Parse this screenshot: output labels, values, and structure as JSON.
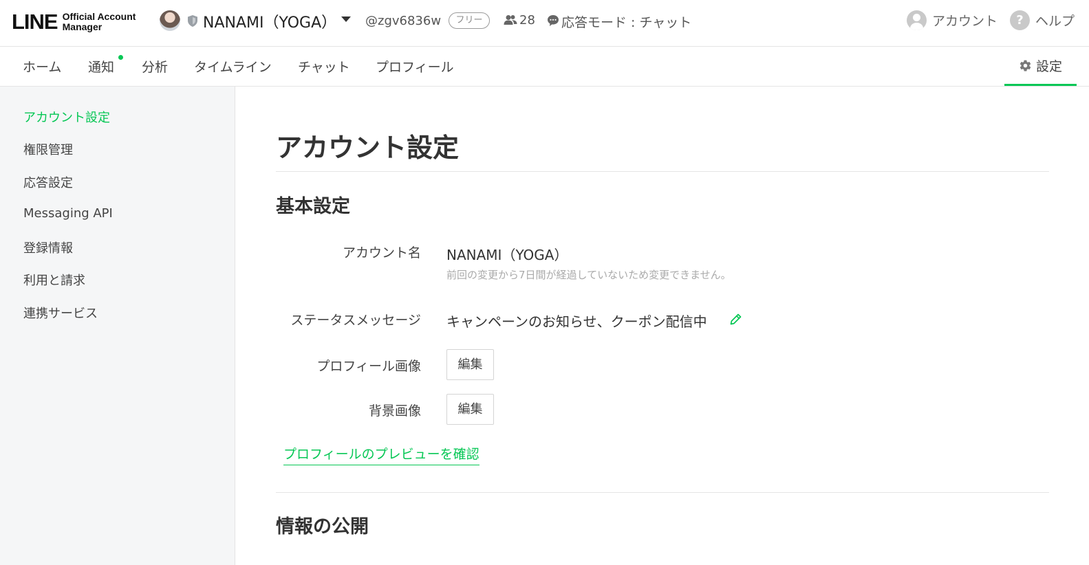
{
  "header": {
    "logo_line": "LINE",
    "logo_sub_1": "Official Account",
    "logo_sub_2": "Manager",
    "account_name": "NANAMI（YOGA）",
    "account_id": "@zgv6836w",
    "plan_badge": "フリー",
    "friends_count": "28",
    "response_mode": "応答モード : チャット",
    "account_link": "アカウント",
    "help_link": "ヘルプ"
  },
  "nav": {
    "items": [
      "ホーム",
      "通知",
      "分析",
      "タイムライン",
      "チャット",
      "プロフィール"
    ],
    "settings": "設定"
  },
  "sidebar": {
    "items": [
      "アカウント設定",
      "権限管理",
      "応答設定",
      "Messaging API",
      "登録情報",
      "利用と請求",
      "連携サービス"
    ],
    "active_index": 0
  },
  "main": {
    "page_title": "アカウント設定",
    "basic_section": "基本設定",
    "account_name_label": "アカウント名",
    "account_name_value": "NANAMI（YOGA）",
    "account_name_note": "前回の変更から7日間が経過していないため変更できません。",
    "status_label": "ステータスメッセージ",
    "status_value": "キャンペーンのお知らせ、クーポン配信中",
    "profile_image_label": "プロフィール画像",
    "profile_image_button": "編集",
    "background_image_label": "背景画像",
    "background_image_button": "編集",
    "preview_link": "プロフィールのプレビューを確認",
    "info_section": "情報の公開"
  },
  "colors": {
    "accent": "#06c755",
    "sidebar_bg": "#f5f6f7"
  }
}
